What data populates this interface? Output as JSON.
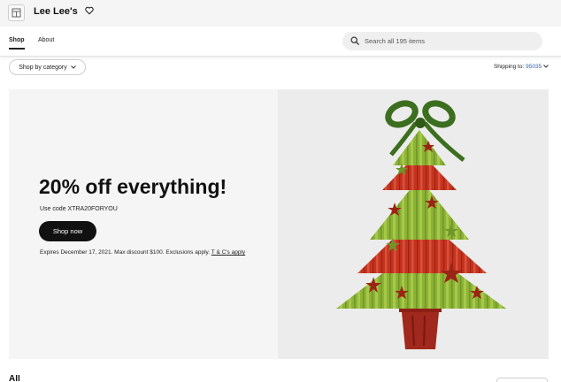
{
  "store": {
    "name": "Lee Lee's",
    "store_icon": "storefront-icon",
    "favorite_icon": "heart-icon"
  },
  "nav": {
    "tabs": [
      {
        "label": "Shop",
        "active": true
      },
      {
        "label": "About",
        "active": false
      }
    ],
    "search": {
      "placeholder": "Search all 195 items",
      "icon": "search-icon"
    }
  },
  "filters": {
    "category_button": "Shop by category",
    "shipping_label": "Shipping to:",
    "shipping_zip": "95035"
  },
  "banner": {
    "headline": "20% off everything!",
    "code_text": "Use code XTRA20FORYOU",
    "button_label": "Shop now",
    "fine_print": "Expires December 17, 2021. Max discount $100. Exclusions apply.",
    "terms_link": "T & C's apply",
    "image": "christmas-tree-illustration",
    "colors": {
      "tree_green": "#8cb236",
      "tree_red": "#c5331f",
      "bow_green": "#3c6e1f",
      "pot": "#a0281c"
    }
  },
  "bottom": {
    "partial_heading": "All"
  }
}
